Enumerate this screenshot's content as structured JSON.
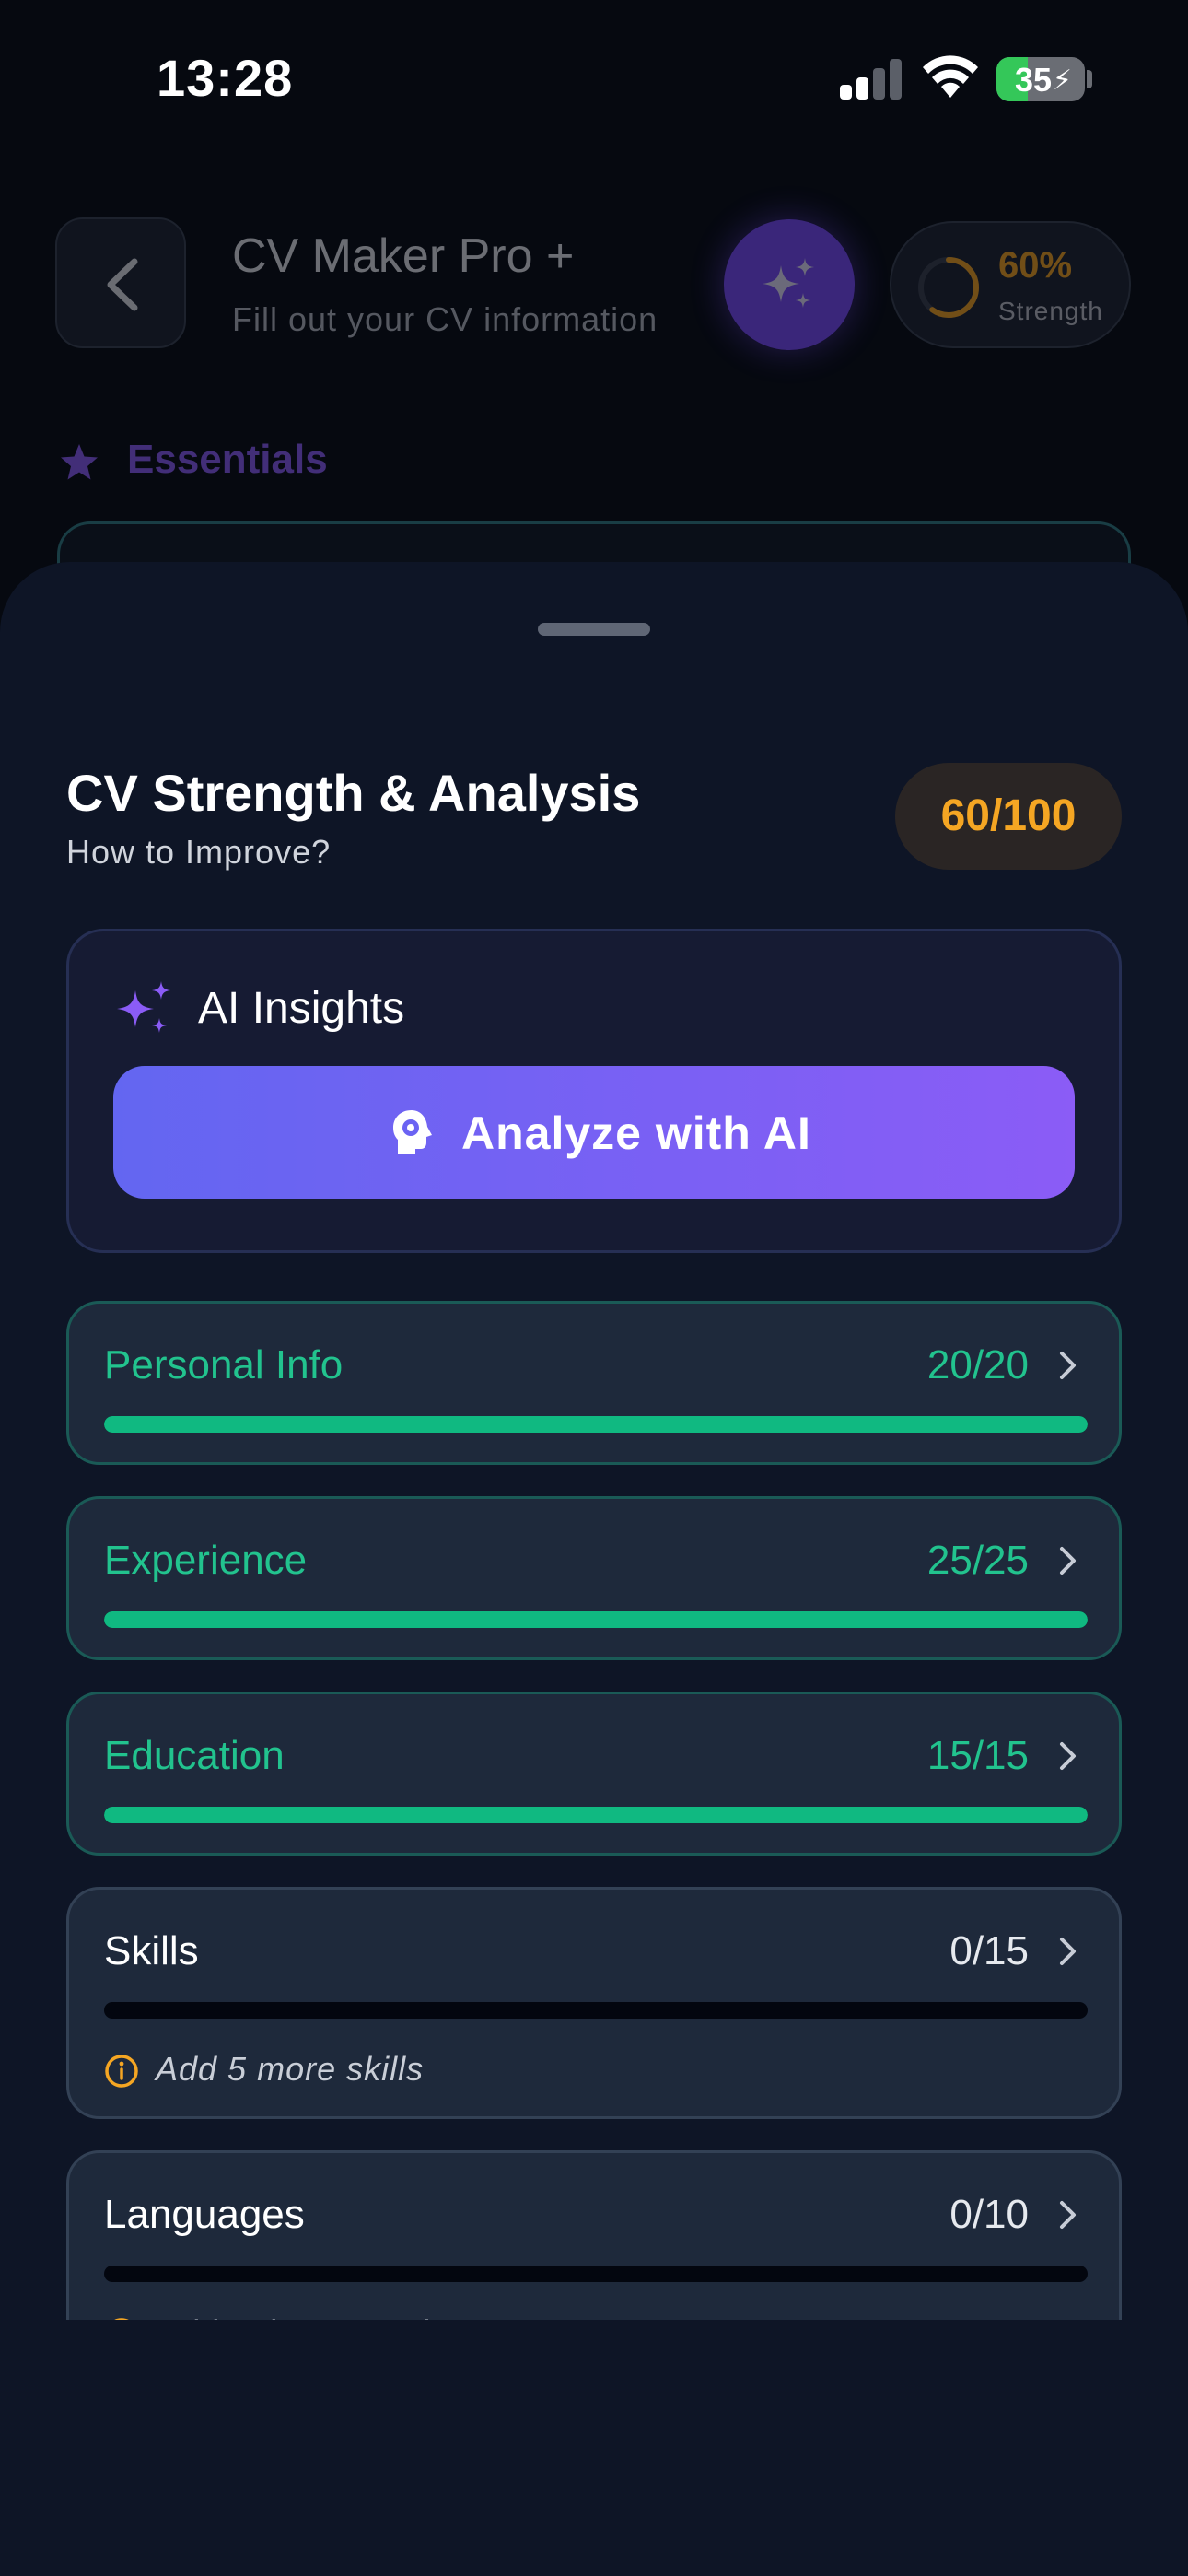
{
  "status_bar": {
    "time": "13:28",
    "battery": "35"
  },
  "header": {
    "title": "CV Maker Pro +",
    "subtitle": "Fill out your CV information",
    "strength_value": "60%",
    "strength_label": "Strength",
    "strength_fraction": 0.6
  },
  "background_section": {
    "label": "Essentials"
  },
  "sheet": {
    "title": "CV Strength & Analysis",
    "subtitle": "How to Improve?",
    "score": "60/100",
    "ai": {
      "title": "AI Insights",
      "button_label": "Analyze with AI"
    },
    "categories": [
      {
        "name": "Personal Info",
        "score": "20/20",
        "progress": 1.0,
        "complete": true,
        "hint": ""
      },
      {
        "name": "Experience",
        "score": "25/25",
        "progress": 1.0,
        "complete": true,
        "hint": ""
      },
      {
        "name": "Education",
        "score": "15/15",
        "progress": 1.0,
        "complete": true,
        "hint": ""
      },
      {
        "name": "Skills",
        "score": "0/15",
        "progress": 0.0,
        "complete": false,
        "hint": "Add 5 more skills"
      },
      {
        "name": "Languages",
        "score": "0/10",
        "progress": 0.0,
        "complete": false,
        "hint": "Add at least one language"
      }
    ]
  },
  "colors": {
    "accent_purple": "#8b5cf6",
    "success_green": "#10b981",
    "warning_orange": "#f5a623",
    "sheet_bg": "#0e1526"
  }
}
